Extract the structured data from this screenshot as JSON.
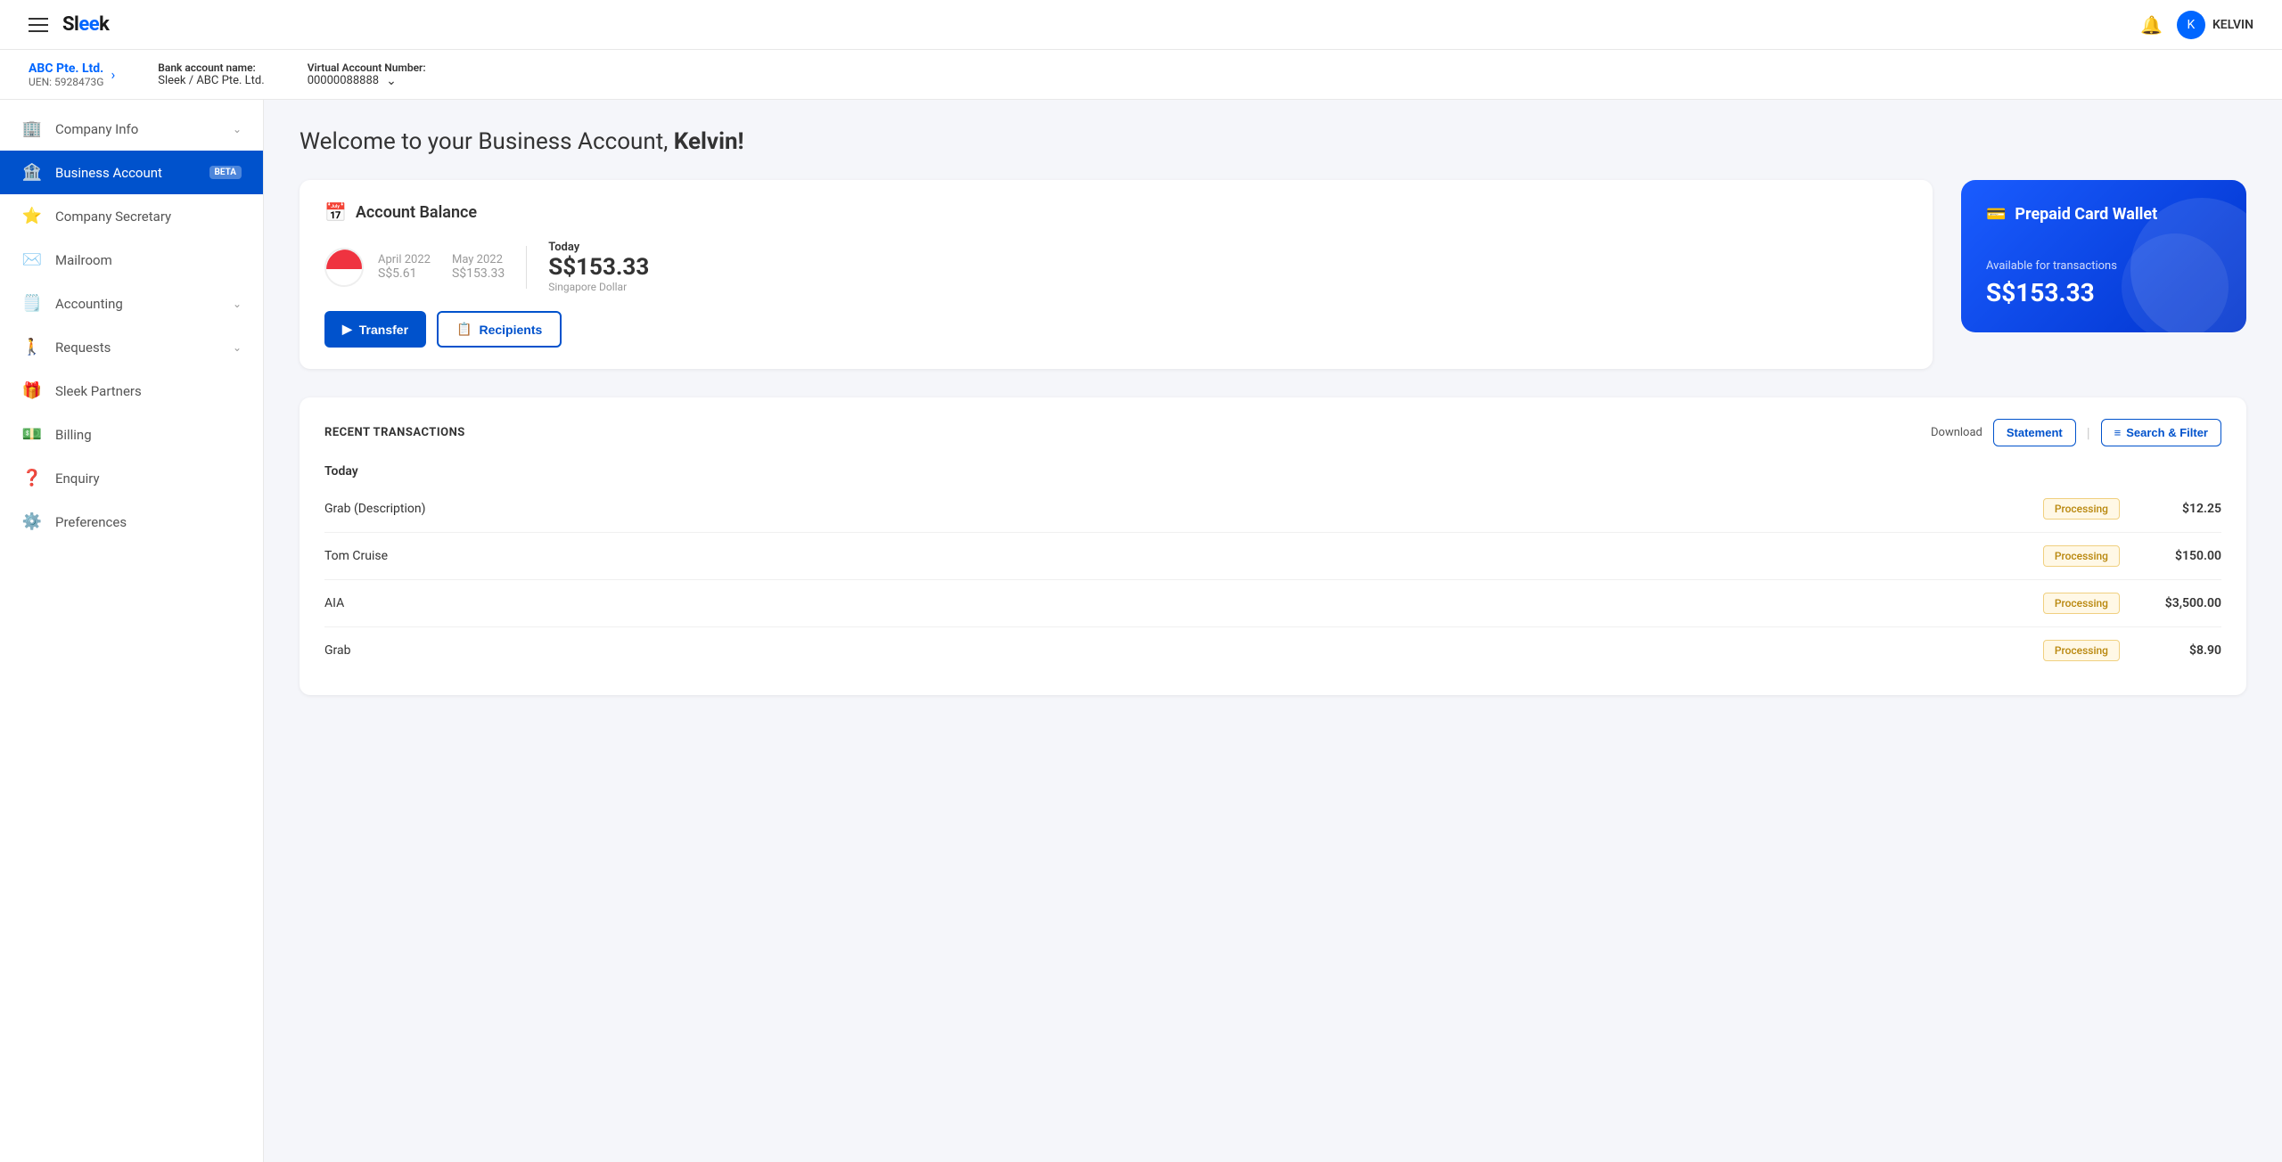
{
  "topnav": {
    "hamburger_label": "Menu",
    "logo_text_1": "Sl",
    "logo_text_2": "eek",
    "bell_label": "Notifications",
    "user_avatar": "K",
    "user_name": "KELVIN"
  },
  "subheader": {
    "company_name": "ABC Pte. Ltd.",
    "company_uen": "UEN: 5928473G",
    "bank_account_label": "Bank account name:",
    "bank_account_value": "Sleek / ABC Pte. Ltd.",
    "virtual_account_label": "Virtual Account Number:",
    "virtual_account_value": "00000088888"
  },
  "sidebar": {
    "items": [
      {
        "id": "company-info",
        "label": "Company Info",
        "icon": "🏢",
        "has_chevron": true,
        "active": false
      },
      {
        "id": "business-account",
        "label": "Business Account",
        "icon": "🏦",
        "has_beta": true,
        "active": true
      },
      {
        "id": "company-secretary",
        "label": "Company Secretary",
        "icon": "⭐",
        "active": false
      },
      {
        "id": "mailroom",
        "label": "Mailroom",
        "icon": "✉️",
        "active": false
      },
      {
        "id": "accounting",
        "label": "Accounting",
        "icon": "🗒️",
        "has_chevron": true,
        "active": false
      },
      {
        "id": "requests",
        "label": "Requests",
        "icon": "🚶",
        "has_chevron": true,
        "active": false
      },
      {
        "id": "sleek-partners",
        "label": "Sleek Partners",
        "icon": "🎁",
        "active": false
      },
      {
        "id": "billing",
        "label": "Billing",
        "icon": "💵",
        "active": false
      },
      {
        "id": "enquiry",
        "label": "Enquiry",
        "icon": "❓",
        "active": false
      },
      {
        "id": "preferences",
        "label": "Preferences",
        "icon": "⚙️",
        "active": false
      }
    ],
    "beta_label": "BETA"
  },
  "main": {
    "welcome_text_1": "Welcome to your Business Account, ",
    "welcome_text_bold": "Kelvin!",
    "balance_section": {
      "title": "Account Balance",
      "month1_label": "April 2022",
      "month1_value": "S$5.61",
      "month2_label": "May 2022",
      "month2_value": "S$153.33",
      "today_label": "Today",
      "today_value": "S$153.33",
      "today_currency": "Singapore Dollar",
      "transfer_btn": "Transfer",
      "recipients_btn": "Recipients"
    },
    "prepaid_card": {
      "title": "Prepaid Card Wallet",
      "available_label": "Available for transactions",
      "amount": "S$153.33"
    },
    "transactions": {
      "title": "RECENT TRANSACTIONS",
      "download_label": "Download",
      "statement_btn": "Statement",
      "filter_btn": "Search & Filter",
      "groups": [
        {
          "label": "Today",
          "rows": [
            {
              "name": "Grab (Description)",
              "status": "Processing",
              "amount": "$12.25"
            },
            {
              "name": "Tom Cruise",
              "status": "Processing",
              "amount": "$150.00"
            },
            {
              "name": "AIA",
              "status": "Processing",
              "amount": "$3,500.00"
            },
            {
              "name": "Grab",
              "status": "Processing",
              "amount": "$8.90"
            }
          ]
        }
      ]
    }
  }
}
